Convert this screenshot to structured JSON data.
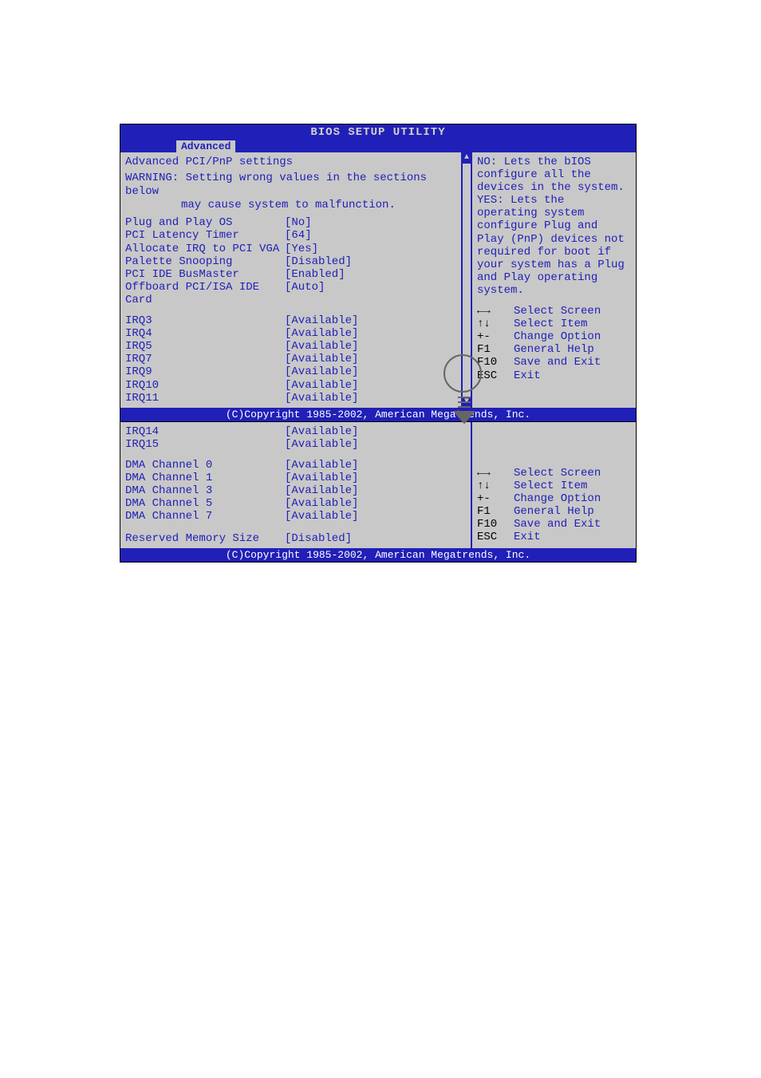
{
  "title": "BIOS SETUP UTILITY",
  "tab": "Advanced",
  "footer": "(C)Copyright 1985-2002, American Megatrends, Inc.",
  "screen1": {
    "panel_title": "Advanced PCI/PnP settings",
    "warning_line1": "WARNING: Setting wrong values in the sections below",
    "warning_line2": "may cause system to malfunction.",
    "settings": [
      {
        "label": "Plug and Play OS",
        "value": "[No]"
      },
      {
        "label": "PCI Latency Timer",
        "value": "[64]"
      },
      {
        "label": "Allocate IRQ to PCI VGA",
        "value": "[Yes]"
      },
      {
        "label": "Palette Snooping",
        "value": "[Disabled]"
      },
      {
        "label": "PCI IDE BusMaster",
        "value": "[Enabled]"
      },
      {
        "label": "Offboard PCI/ISA IDE Card",
        "value": "[Auto]"
      }
    ],
    "irqs": [
      {
        "label": "IRQ3",
        "value": "[Available]"
      },
      {
        "label": "IRQ4",
        "value": "[Available]"
      },
      {
        "label": "IRQ5",
        "value": "[Available]"
      },
      {
        "label": "IRQ7",
        "value": "[Available]"
      },
      {
        "label": "IRQ9",
        "value": "[Available]"
      },
      {
        "label": "IRQ10",
        "value": "[Available]"
      },
      {
        "label": "IRQ11",
        "value": "[Available]"
      }
    ],
    "help": [
      "NO: Lets the bIOS",
      "configure all the",
      "devices in the system.",
      "YES: Lets the",
      "operating system",
      "configure Plug and",
      "Play (PnP) devices not",
      "required for boot if",
      "your system has a Plug",
      "and Play operating",
      "system."
    ],
    "keys": [
      {
        "sym": "←→",
        "desc": "Select Screen"
      },
      {
        "sym": "↑↓",
        "desc": "Select Item"
      },
      {
        "sym": "+-",
        "desc": "Change Option"
      },
      {
        "sym": "F1",
        "desc": "General Help"
      },
      {
        "sym": "F10",
        "desc": "Save and Exit"
      },
      {
        "sym": "ESC",
        "desc": "Exit"
      }
    ]
  },
  "screen2": {
    "irqs": [
      {
        "label": "IRQ14",
        "value": "[Available]"
      },
      {
        "label": "IRQ15",
        "value": "[Available]"
      }
    ],
    "dmas": [
      {
        "label": "DMA Channel 0",
        "value": "[Available]"
      },
      {
        "label": "DMA Channel 1",
        "value": "[Available]"
      },
      {
        "label": "DMA Channel 3",
        "value": "[Available]"
      },
      {
        "label": "DMA Channel 5",
        "value": "[Available]"
      },
      {
        "label": "DMA Channel 7",
        "value": "[Available]"
      }
    ],
    "reserved": {
      "label": "Reserved Memory Size",
      "value": "[Disabled]"
    },
    "keys": [
      {
        "sym": "←→",
        "desc": "Select Screen"
      },
      {
        "sym": "↑↓",
        "desc": "Select Item"
      },
      {
        "sym": "+-",
        "desc": "Change Option"
      },
      {
        "sym": "F1",
        "desc": "General Help"
      },
      {
        "sym": "F10",
        "desc": "Save and Exit"
      },
      {
        "sym": "ESC",
        "desc": "Exit"
      }
    ]
  }
}
